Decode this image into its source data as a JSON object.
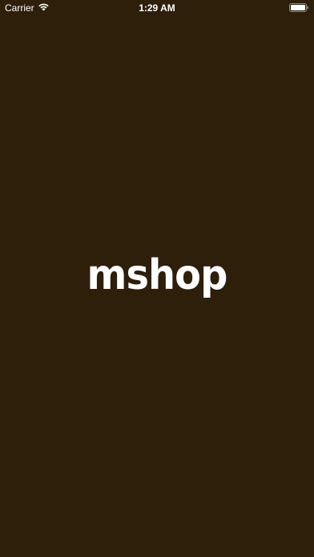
{
  "status_bar": {
    "carrier": "Carrier",
    "time": "1:29 AM",
    "wifi_icon": "wifi-icon",
    "battery_icon": "battery-icon"
  },
  "splash": {
    "logo_text": "mshop",
    "background_color": "#2d1f0a",
    "text_color": "#ffffff"
  }
}
